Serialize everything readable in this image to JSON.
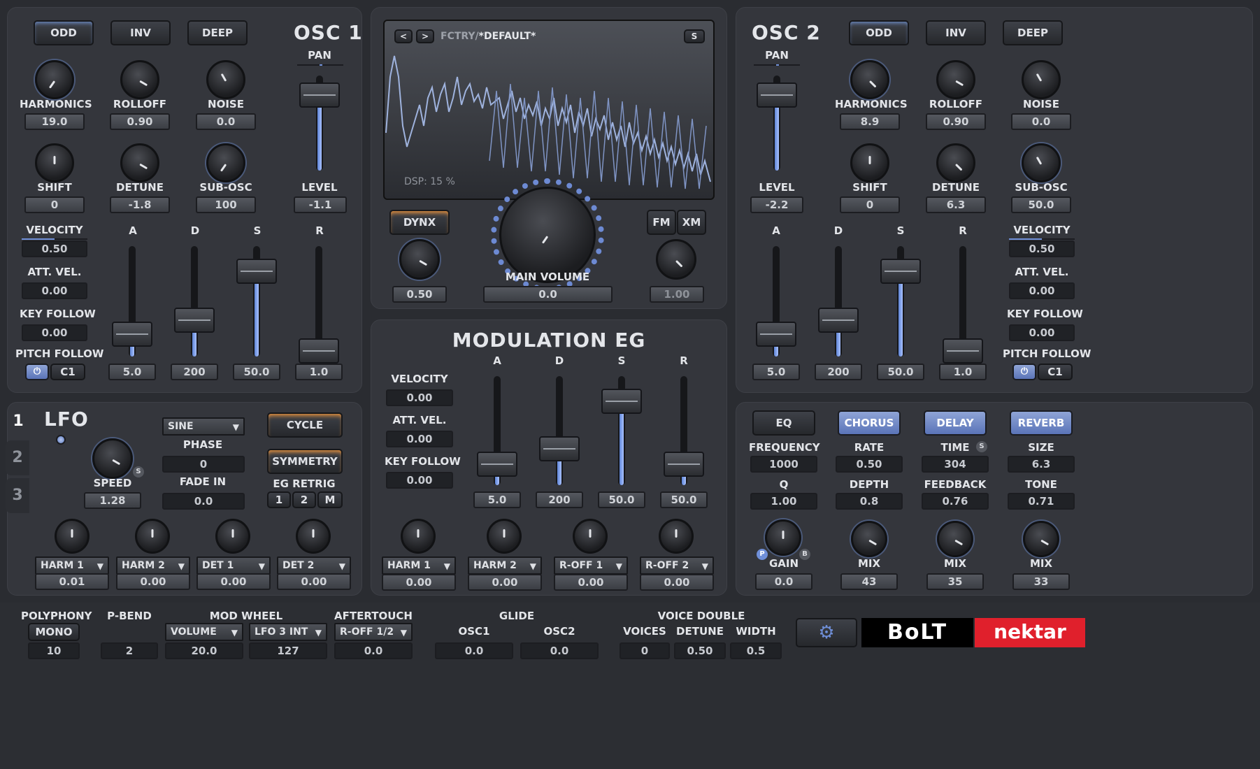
{
  "osc1": {
    "title": "OSC 1",
    "buttons": [
      "ODD",
      "INV",
      "DEEP"
    ],
    "pan_label": "PAN",
    "knobs_row1": [
      {
        "label": "HARMONICS",
        "value": "19.0"
      },
      {
        "label": "ROLLOFF",
        "value": "0.90"
      },
      {
        "label": "NOISE",
        "value": "0.0"
      }
    ],
    "knobs_row2": [
      {
        "label": "SHIFT",
        "value": "0"
      },
      {
        "label": "DETUNE",
        "value": "-1.8"
      },
      {
        "label": "SUB-OSC",
        "value": "100"
      }
    ],
    "level_label": "LEVEL",
    "level_value": "-1.1",
    "velocity": {
      "label": "VELOCITY",
      "value": "0.50"
    },
    "att_vel": {
      "label": "ATT. VEL.",
      "value": "0.00"
    },
    "key_follow": {
      "label": "KEY FOLLOW",
      "value": "0.00"
    },
    "pitch_follow": {
      "label": "PITCH FOLLOW",
      "note": "C1"
    },
    "adsr_labels": [
      "A",
      "D",
      "S",
      "R"
    ],
    "adsr_values": [
      "5.0",
      "200",
      "50.0",
      "1.0"
    ]
  },
  "osc2": {
    "title": "OSC 2",
    "buttons": [
      "ODD",
      "INV",
      "DEEP"
    ],
    "pan_label": "PAN",
    "knobs_row1": [
      {
        "label": "HARMONICS",
        "value": "8.9"
      },
      {
        "label": "ROLLOFF",
        "value": "0.90"
      },
      {
        "label": "NOISE",
        "value": "0.0"
      }
    ],
    "knobs_row2": [
      {
        "label": "SHIFT",
        "value": "0"
      },
      {
        "label": "DETUNE",
        "value": "6.3"
      },
      {
        "label": "SUB-OSC",
        "value": "50.0"
      }
    ],
    "level_label": "LEVEL",
    "level_value": "-2.2",
    "velocity": {
      "label": "VELOCITY",
      "value": "0.50"
    },
    "att_vel": {
      "label": "ATT. VEL.",
      "value": "0.00"
    },
    "key_follow": {
      "label": "KEY FOLLOW",
      "value": "0.00"
    },
    "pitch_follow": {
      "label": "PITCH FOLLOW",
      "note": "C1"
    },
    "adsr_labels": [
      "A",
      "D",
      "S",
      "R"
    ],
    "adsr_values": [
      "5.0",
      "200",
      "50.0",
      "1.0"
    ]
  },
  "display": {
    "prev": "<",
    "next": ">",
    "preset_prefix": "FCTRY/",
    "preset_name": "*DEFAULT*",
    "save": "S",
    "dsp": "DSP: 15 %"
  },
  "master": {
    "dynx_label": "DYNX",
    "dynx_value": "0.50",
    "main_volume_label": "MAIN VOLUME",
    "main_volume_value": "0.0",
    "fm_label": "FM",
    "xm_label": "XM",
    "fmxm_value": "1.00"
  },
  "mod_eg": {
    "title": "MODULATION EG",
    "velocity": {
      "label": "VELOCITY",
      "value": "0.00"
    },
    "att_vel": {
      "label": "ATT. VEL.",
      "value": "0.00"
    },
    "key_follow": {
      "label": "KEY FOLLOW",
      "value": "0.00"
    },
    "adsr_labels": [
      "A",
      "D",
      "S",
      "R"
    ],
    "adsr_values": [
      "5.0",
      "200",
      "50.0",
      "50.0"
    ],
    "targets": [
      {
        "name": "HARM 1",
        "value": "0.00"
      },
      {
        "name": "HARM 2",
        "value": "0.00"
      },
      {
        "name": "R-OFF 1",
        "value": "0.00"
      },
      {
        "name": "R-OFF 2",
        "value": "0.00"
      }
    ]
  },
  "lfo": {
    "tabs": [
      "1",
      "2",
      "3"
    ],
    "title": "LFO",
    "wave": "SINE",
    "cycle": "CYCLE",
    "phase": {
      "label": "PHASE",
      "value": "0"
    },
    "symmetry": "SYMMETRY",
    "speed": {
      "label": "SPEED",
      "value": "1.28",
      "sync": "S"
    },
    "fade_in": {
      "label": "FADE IN",
      "value": "0.0"
    },
    "eg_retrig": {
      "label": "EG RETRIG",
      "buttons": [
        "1",
        "2",
        "M"
      ]
    },
    "targets": [
      {
        "name": "HARM 1",
        "value": "0.01"
      },
      {
        "name": "HARM 2",
        "value": "0.00"
      },
      {
        "name": "DET 1",
        "value": "0.00"
      },
      {
        "name": "DET 2",
        "value": "0.00"
      }
    ]
  },
  "fx": {
    "tabs": [
      "EQ",
      "CHORUS",
      "DELAY",
      "REVERB"
    ],
    "eq": {
      "freq_label": "FREQUENCY",
      "freq": "1000",
      "q_label": "Q",
      "q": "1.00",
      "gain_label": "GAIN",
      "gain": "0.0",
      "p": "P",
      "b": "B"
    },
    "chorus": {
      "rate_label": "RATE",
      "rate": "0.50",
      "depth_label": "DEPTH",
      "depth": "0.8",
      "mix_label": "MIX",
      "mix": "43"
    },
    "delay": {
      "time_label": "TIME",
      "time": "304",
      "sync": "S",
      "fb_label": "FEEDBACK",
      "fb": "0.76",
      "mix_label": "MIX",
      "mix": "35"
    },
    "reverb": {
      "size_label": "SIZE",
      "size": "6.3",
      "tone_label": "TONE",
      "tone": "0.71",
      "mix_label": "MIX",
      "mix": "33"
    }
  },
  "footer": {
    "polyphony": {
      "label": "POLYPHONY",
      "mode": "MONO",
      "value": "10"
    },
    "pbend": {
      "label": "P-BEND",
      "value": "2"
    },
    "modwheel": {
      "label": "MOD WHEEL",
      "dest1": "VOLUME",
      "val1": "20.0",
      "dest2": "LFO 3 INT",
      "val2": "127"
    },
    "aftertouch": {
      "label": "AFTERTOUCH",
      "dest": "R-OFF 1/2",
      "value": "0.0"
    },
    "glide": {
      "label": "GLIDE",
      "osc1_label": "OSC1",
      "osc1": "0.0",
      "osc2_label": "OSC2",
      "osc2": "0.0"
    },
    "voice_double": {
      "label": "VOICE DOUBLE",
      "voices_label": "VOICES",
      "voices": "0",
      "detune_label": "DETUNE",
      "detune": "0.50",
      "width_label": "WIDTH",
      "width": "0.5"
    },
    "brand": "BoLT",
    "maker": "nektar"
  },
  "colors": {
    "accent_blue": "#6f8fd8",
    "orange": "#ff9c3a",
    "brand_red": "#e0202c"
  }
}
